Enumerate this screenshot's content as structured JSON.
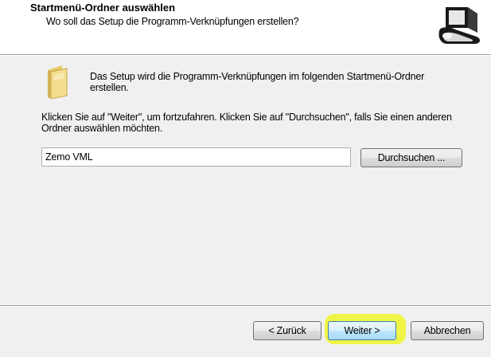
{
  "header": {
    "title": "Startmenü-Ordner auswählen",
    "subtitle": "Wo soll das Setup die Programm-Verknüpfungen erstellen?",
    "icon": "setup-computer-icon"
  },
  "main": {
    "folder_icon": "folder-icon",
    "intro_text": "Das Setup wird die Programm-Verknüpfungen im folgenden Startmenü-Ordner erstellen.",
    "instruction_text": "Klicken Sie auf \"Weiter\", um fortzufahren. Klicken Sie auf \"Durchsuchen\", falls Sie einen anderen Ordner auswählen möchten.",
    "folder_input_value": "Zemo VML",
    "browse_label": "Durchsuchen ..."
  },
  "footer": {
    "back_label": "< Zurück",
    "next_label": "Weiter >",
    "cancel_label": "Abbrechen",
    "highlight_color": "#eef533"
  }
}
